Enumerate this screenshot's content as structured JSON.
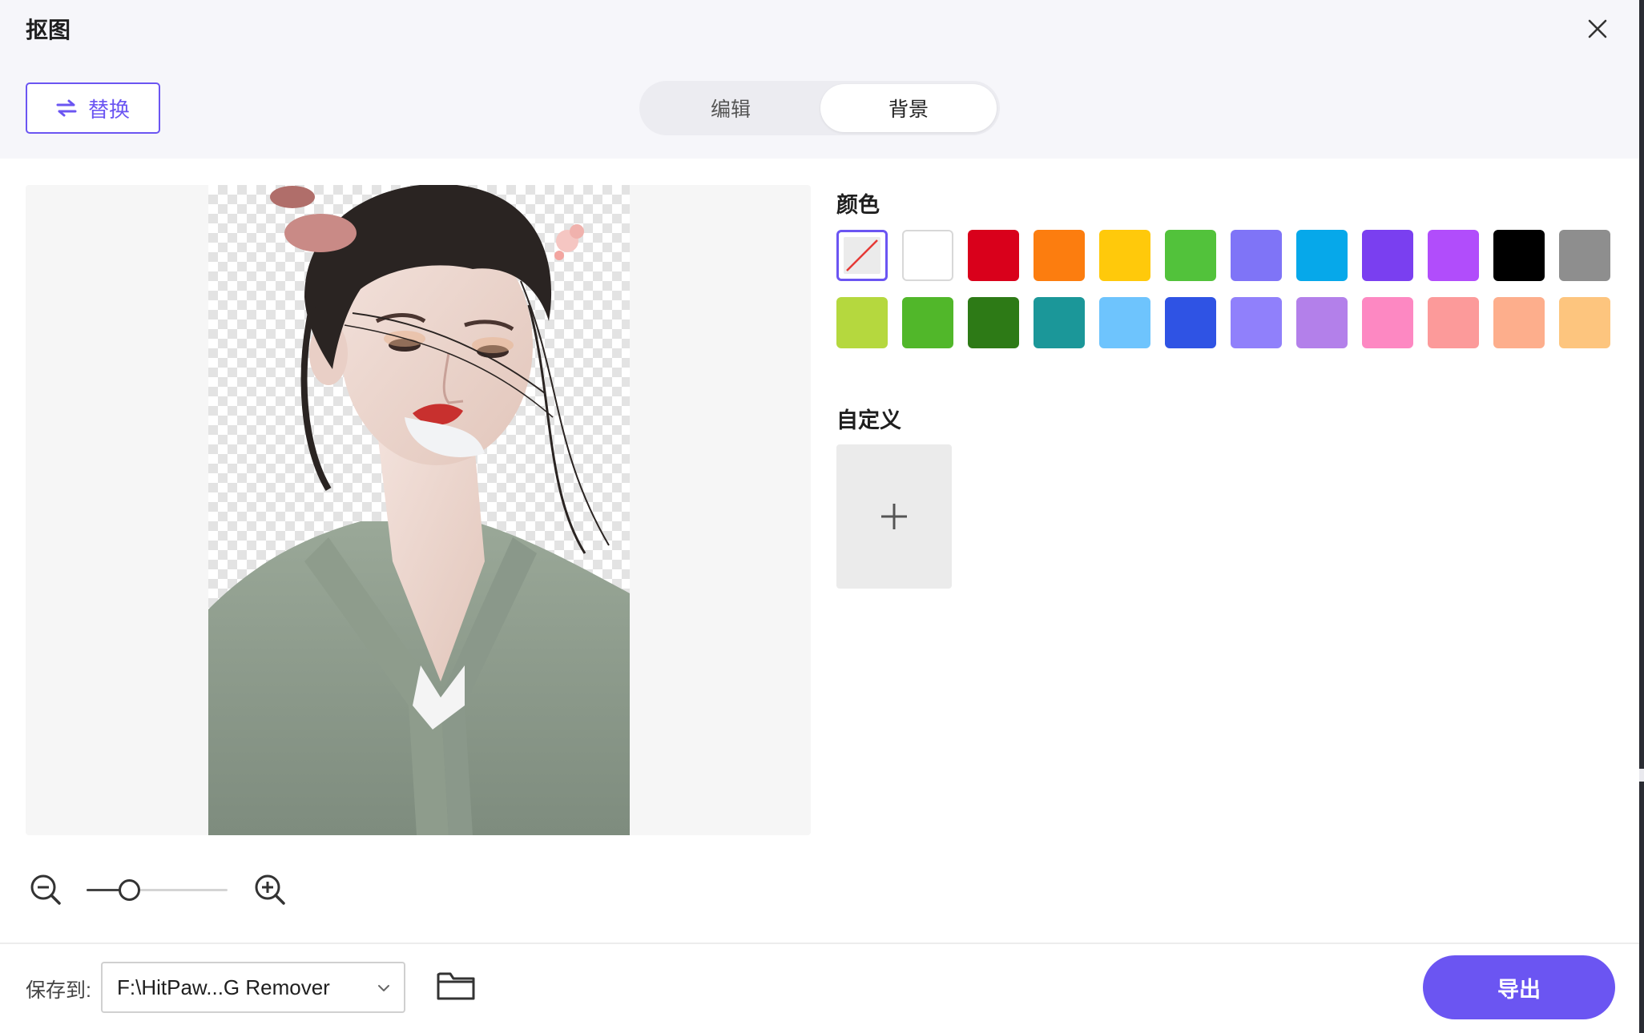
{
  "window": {
    "title": "抠图"
  },
  "toolbar": {
    "replace_label": "替换",
    "tabs": [
      {
        "label": "编辑",
        "active": false
      },
      {
        "label": "背景",
        "active": true
      }
    ]
  },
  "background_panel": {
    "color_label": "颜色",
    "custom_label": "自定义",
    "colors_row1": [
      "none",
      "#ffffff",
      "#d9001b",
      "#fc7d0f",
      "#ffc90b",
      "#52c23b",
      "#7f74f7",
      "#06a8ea",
      "#7a3ff0",
      "#b14dfb",
      "#000000",
      "#8e8e8e"
    ],
    "colors_row2": [
      "#b5d83e",
      "#51b72a",
      "#2d7a16",
      "#1b9799",
      "#6ec4fd",
      "#2f53e4",
      "#9080fb",
      "#b380ea",
      "#fd88c2",
      "#fc9a9a",
      "#fdae8c",
      "#fdc57e"
    ],
    "selected": "none"
  },
  "zoom": {
    "level": 0.3
  },
  "footer": {
    "save_to_label": "保存到:",
    "save_path": "F:\\HitPaw...G Remover",
    "export_label": "导出"
  },
  "colors": {
    "accent": "#6b55f2",
    "header_bg": "#f6f6fa"
  }
}
